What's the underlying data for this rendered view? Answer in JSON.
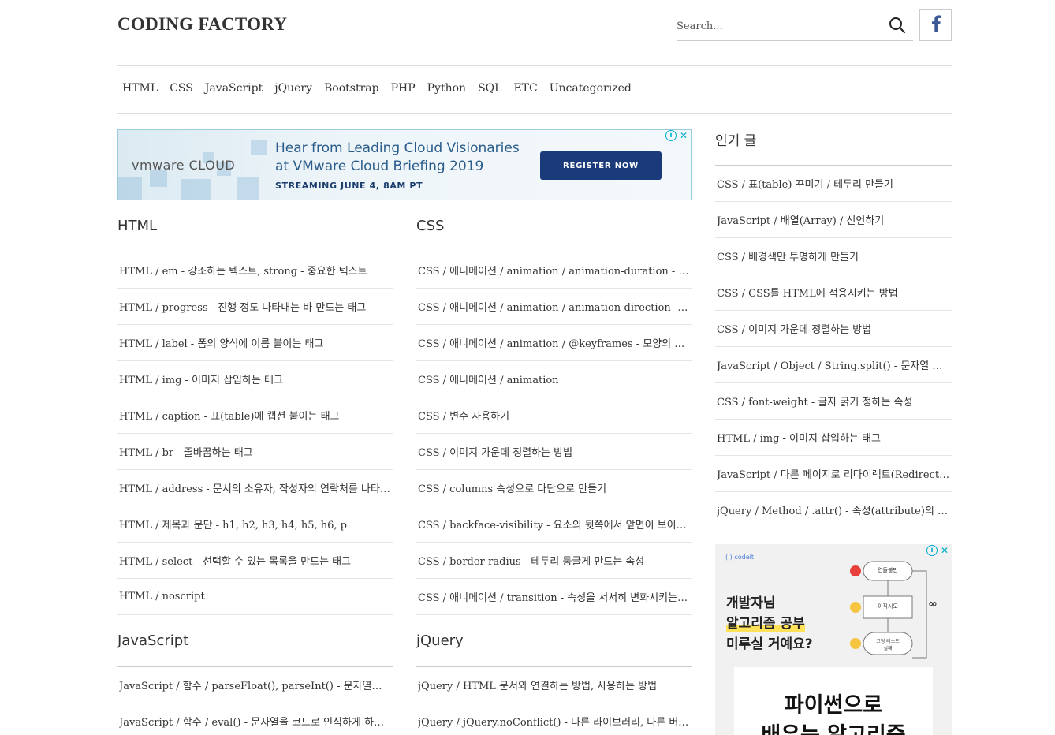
{
  "site": {
    "title": "CODING FACTORY"
  },
  "search": {
    "placeholder": "Search..."
  },
  "nav": [
    "HTML",
    "CSS",
    "JavaScript",
    "jQuery",
    "Bootstrap",
    "PHP",
    "Python",
    "SQL",
    "ETC",
    "Uncategorized"
  ],
  "ad_banner": {
    "brand": "vmware CLOUD",
    "headline_1": "Hear from Leading Cloud Visionaries",
    "headline_2": "at VMware Cloud Briefing 2019",
    "subline": "STREAMING JUNE 4, 8AM PT",
    "cta": "REGISTER NOW",
    "info_icon": "i",
    "close_icon": "✕"
  },
  "sections": {
    "html": {
      "title": "HTML",
      "posts": [
        "HTML / em - 강조하는 텍스트, strong - 중요한 텍스트",
        "HTML / progress - 진행 정도 나타내는 바 만드는 태그",
        "HTML / label - 폼의 양식에 이름 붙이는 태그",
        "HTML / img - 이미지 삽입하는 태그",
        "HTML / caption - 표(table)에 캡션 붙이는 태그",
        "HTML / br - 줄바꿈하는 태그",
        "HTML / address - 문서의 소유자, 작성자의 연락처를 나타내는 태그",
        "HTML / 제목과 문단 - h1, h2, h3, h4, h5, h6, p",
        "HTML / select - 선택할 수 있는 목록을 만드는 태그",
        "HTML / noscript"
      ]
    },
    "css": {
      "title": "CSS",
      "posts": [
        "CSS / 애니메이션 / animation / animation-duration - 애니메이션 재생 시간",
        "CSS / 애니메이션 / animation / animation-direction - 애니메이션 방향",
        "CSS / 애니메이션 / animation / @keyframes - 모양의 변화",
        "CSS / 애니메이션 / animation",
        "CSS / 변수 사용하기",
        "CSS / 이미지 가운데 정렬하는 방법",
        "CSS / columns 속성으로 다단으로 만들기",
        "CSS / backface-visibility - 요소의 뒷쪽에서 앞면이 보이게 할지 정하는 속성",
        "CSS / border-radius - 테두리 둥글게 만드는 속성",
        "CSS / 애니메이션 / transition - 속성을 서서히 변화시키는 속성"
      ]
    },
    "javascript": {
      "title": "JavaScript",
      "posts": [
        "JavaScript / 함수 / parseFloat(), parseInt() - 문자열을 숫자로 바꾸는 함수",
        "JavaScript / 함수 / eval() - 문자열을 코드로 인식하게 하는 함수"
      ]
    },
    "jquery": {
      "title": "jQuery",
      "posts": [
        "jQuery / HTML 문서와 연결하는 방법, 사용하는 방법",
        "jQuery / jQuery.noConflict() - 다른 라이브러리, 다른 버전과의 충돌 방지"
      ]
    }
  },
  "sidebar": {
    "title": "인기 글",
    "posts": [
      "CSS / 표(table) 꾸미기 / 테두리 만들기",
      "JavaScript / 배열(Array) / 선언하기",
      "CSS / 배경색만 투명하게 만들기",
      "CSS / CSS를 HTML에 적용시키는 방법",
      "CSS / 이미지 가운데 정렬하는 방법",
      "JavaScript / Object / String.split() - 문자열 분할하기",
      "CSS / font-weight - 글자 굵기 정하는 속성",
      "HTML / img - 이미지 삽입하는 태그",
      "JavaScript / 다른 페이지로 리다이렉트(Redirect)하는 방법",
      "jQuery / Method / .attr() - 속성(attribute)의 값 가져오기, 추가하기"
    ]
  },
  "ad_side": {
    "brand": "(·) codeit",
    "line1": "개발자님",
    "line2": "알고리즘 공부",
    "line3": "미루실 거예요?",
    "flow_1": "연들불만",
    "flow_2": "이직시도",
    "flow_3a": "코딩 테스트",
    "flow_3b": "실패",
    "infinity": "∞",
    "card_line1": "파이썬으로",
    "card_line2": "배우는 알고리즘"
  },
  "colors": {
    "text": "#333333",
    "accent_fb": "#3b5998",
    "ad_cta": "#1b3a7a"
  }
}
